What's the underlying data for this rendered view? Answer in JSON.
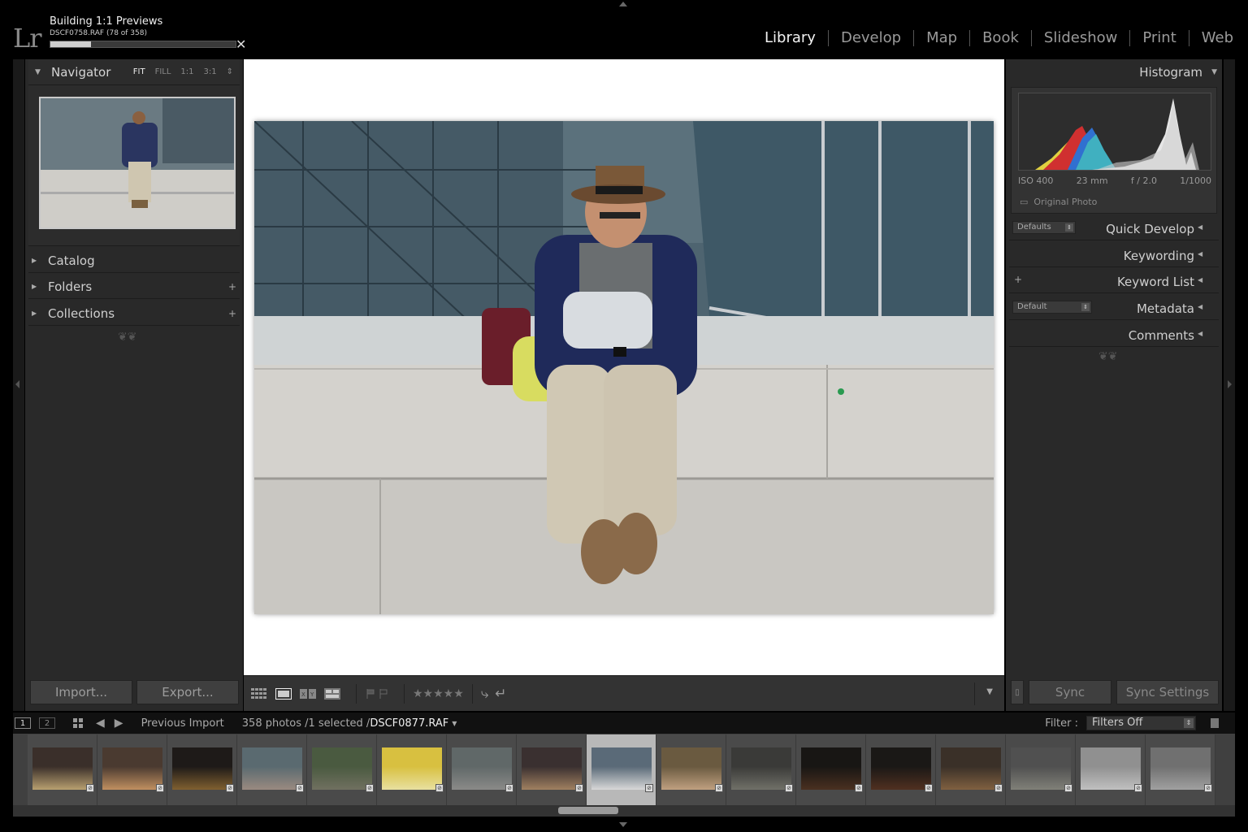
{
  "app": {
    "logo": "Lr",
    "task_title": "Building 1:1 Previews",
    "task_sub": "DSCF0758.RAF (78 of 358)",
    "task_progress": 0.22
  },
  "modules": [
    {
      "label": "Library",
      "active": true
    },
    {
      "label": "Develop",
      "active": false
    },
    {
      "label": "Map",
      "active": false
    },
    {
      "label": "Book",
      "active": false
    },
    {
      "label": "Slideshow",
      "active": false
    },
    {
      "label": "Print",
      "active": false
    },
    {
      "label": "Web",
      "active": false
    }
  ],
  "left_panel": {
    "navigator": {
      "title": "Navigator",
      "options": [
        "FIT",
        "FILL",
        "1:1",
        "3:1"
      ],
      "active_option": "FIT"
    },
    "sections": [
      {
        "label": "Catalog",
        "plus": ""
      },
      {
        "label": "Folders",
        "plus": "+"
      },
      {
        "label": "Collections",
        "plus": "+"
      }
    ],
    "import_label": "Import...",
    "export_label": "Export..."
  },
  "toolbar": {
    "stars": "★★★★★"
  },
  "right_panel": {
    "histogram": {
      "title": "Histogram",
      "iso": "ISO 400",
      "focal": "23 mm",
      "aperture": "f / 2.0",
      "shutter": "1/1000",
      "original_photo": "Original Photo"
    },
    "quick_develop": {
      "label": "Quick Develop",
      "preset": "Defaults"
    },
    "keywording": "Keywording",
    "keyword_list": "Keyword List",
    "metadata": {
      "label": "Metadata",
      "preset": "Default"
    },
    "comments": "Comments",
    "sync_label": "Sync",
    "sync_settings_label": "Sync Settings"
  },
  "filmstrip_bar": {
    "screen1": "1",
    "screen2": "2",
    "source": "Previous Import",
    "count": "358 photos /1 selected /",
    "filename": "DSCF0877.RAF",
    "filter_label": "Filter :",
    "filter_value": "Filters Off"
  },
  "filmstrip": {
    "selected_index": 8,
    "thumb_colors": [
      [
        "#3a2f2a",
        "#b8a070"
      ],
      [
        "#4a3a30",
        "#c09060"
      ],
      [
        "#1e1a18",
        "#806030"
      ],
      [
        "#5a6a70",
        "#9a8a80"
      ],
      [
        "#4a5a40",
        "#707060"
      ],
      [
        "#d8c040",
        "#e8e0a0"
      ],
      [
        "#606868",
        "#8a8a88"
      ],
      [
        "#3a3030",
        "#a08060"
      ],
      [
        "#5a6a78",
        "#d8d8d8"
      ],
      [
        "#6a5a40",
        "#c0a080"
      ],
      [
        "#3a3a38",
        "#707068"
      ],
      [
        "#181614",
        "#4a3020"
      ],
      [
        "#1a1816",
        "#503020"
      ],
      [
        "#3a3028",
        "#806040"
      ],
      [
        "#505050",
        "#808078"
      ],
      [
        "#909090",
        "#c0c0c0"
      ],
      [
        "#707070",
        "#a0a0a0"
      ]
    ]
  },
  "colors": {
    "accent_text": "#f2f2f2",
    "panel_bg": "#292929"
  }
}
